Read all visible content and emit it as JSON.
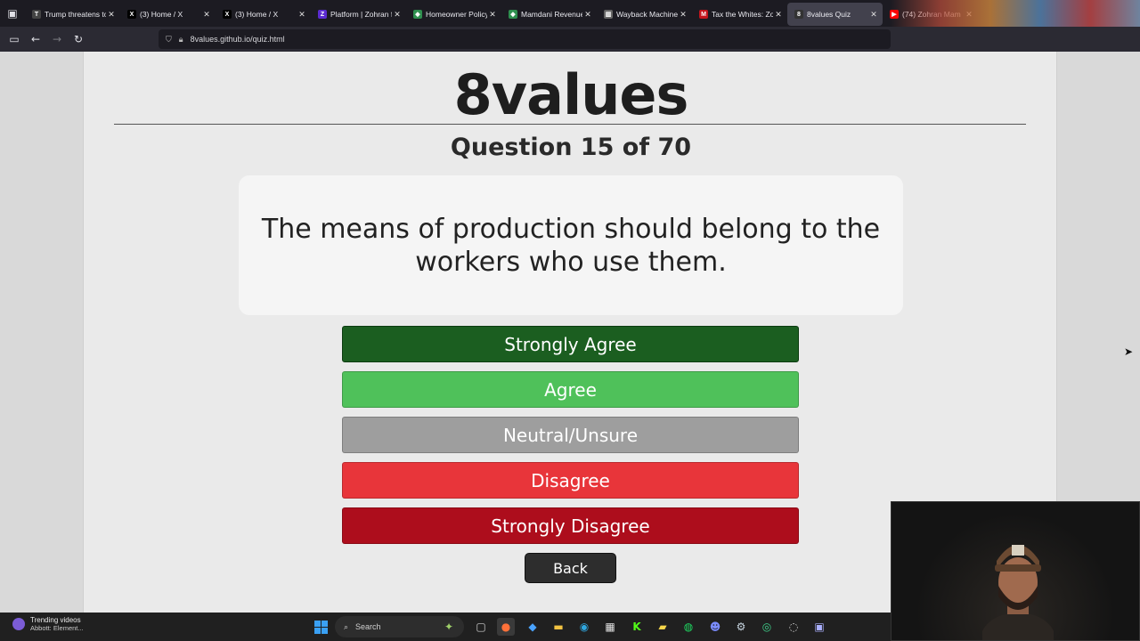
{
  "browser": {
    "tabs": [
      {
        "title": "Trump threatens to",
        "favicon": "T",
        "favicon_color": "#444444",
        "active": false
      },
      {
        "title": "(3) Home / X",
        "favicon": "X",
        "favicon_color": "#000000",
        "active": false
      },
      {
        "title": "(3) Home / X",
        "favicon": "X",
        "favicon_color": "#000000",
        "active": false
      },
      {
        "title": "Platform | Zohran fo",
        "favicon": "Z",
        "favicon_color": "#5b2bd1",
        "active": false
      },
      {
        "title": "Homeowner Policy",
        "favicon": "◆",
        "favicon_color": "#2f8f4f",
        "active": false
      },
      {
        "title": "Mamdani Revenue",
        "favicon": "◆",
        "favicon_color": "#2f8f4f",
        "active": false
      },
      {
        "title": "Wayback Machine",
        "favicon": "▥",
        "favicon_color": "#666666",
        "active": false
      },
      {
        "title": "Tax the Whites: Zoh",
        "favicon": "M",
        "favicon_color": "#c4151c",
        "active": false
      },
      {
        "title": "8values Quiz",
        "favicon": "8",
        "favicon_color": "#333333",
        "active": true
      },
      {
        "title": "(74) Zohran Mam",
        "favicon": "▶",
        "favicon_color": "#ff0000",
        "active": false
      }
    ],
    "url": "8values.github.io/quiz.html"
  },
  "page": {
    "site_title": "8values",
    "question_number": "Question 15 of 70",
    "question_text": "The means of production should belong to the workers who use them.",
    "answers": {
      "strongly_agree": "Strongly Agree",
      "agree": "Agree",
      "neutral": "Neutral/Unsure",
      "disagree": "Disagree",
      "strongly_disagree": "Strongly Disagree"
    },
    "back_label": "Back"
  },
  "taskbar": {
    "widget_title": "Trending videos",
    "widget_subtitle": "Abbott: Element...",
    "search_placeholder": "Search"
  },
  "colors": {
    "strongly_agree": "#1b5e20",
    "agree": "#4fc15a",
    "neutral": "#9e9e9e",
    "disagree": "#e8353a",
    "strongly_disagree": "#ad0d1c"
  }
}
